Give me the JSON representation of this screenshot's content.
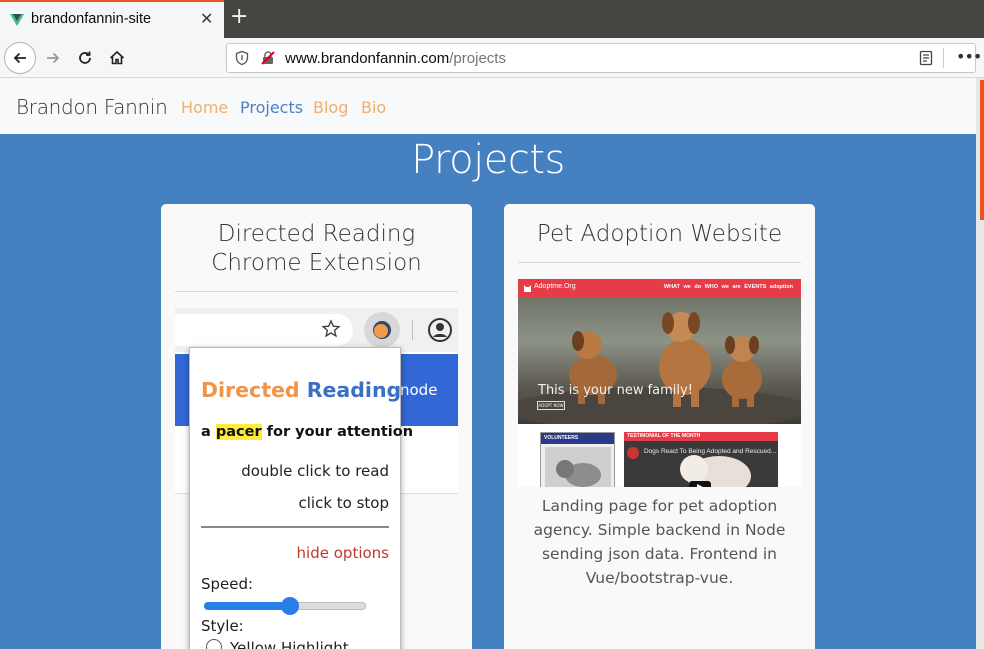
{
  "browser": {
    "tab_title": "brandonfannin-site",
    "tab_close": "✕",
    "new_tab": "+",
    "url_host": "www.brandonfannin.com",
    "url_path": "/projects",
    "menu_dots": "•••"
  },
  "site": {
    "brand": "Brandon Fannin",
    "nav": [
      {
        "label": "Home",
        "color": "#f0ad6e"
      },
      {
        "label": "Projects",
        "color": "#4a83c4"
      },
      {
        "label": "Blog",
        "color": "#f0ad6e"
      },
      {
        "label": "Bio",
        "color": "#f0ad6e"
      }
    ]
  },
  "page": {
    "title": "Projects",
    "cards": [
      {
        "title": "Directed Reading Chrome Extension",
        "screenshot": {
          "mode_text": "node",
          "popup": {
            "head_part1": "Directed",
            "head_part2": "Reading",
            "head_color1": "#f0944a",
            "head_color2": "#3a6fc4",
            "tagline_pre": "a",
            "tagline_hl": "pacer",
            "tagline_post": "for your attention",
            "instr1": "double click to read",
            "instr2": "click to stop",
            "hide_options": "hide options",
            "speed_label": "Speed:",
            "speed_level": 0.53,
            "style_label": "Style:",
            "style_option": "Yellow Highlight"
          }
        }
      },
      {
        "title": "Pet Adoption Website",
        "screenshot": {
          "logo": "Adoptme.Org",
          "links": "WHAT we do  WHO we are  EVENTS adoption",
          "hero_text": "This is your new family!",
          "hero_button": "ADOPT NOW",
          "volunteers": "VOLUNTEERS",
          "testimonial": "TESTIMONIAL OF THE MONTH",
          "video_title": "Dogs React To Being Adopted and Rescued..."
        },
        "description": "Landing page for pet adoption agency. Simple backend in Node sending json data. Frontend in Vue/bootstrap-vue."
      }
    ]
  },
  "colors": {
    "page_bg": "#4580c0",
    "accent": "#e95420"
  }
}
